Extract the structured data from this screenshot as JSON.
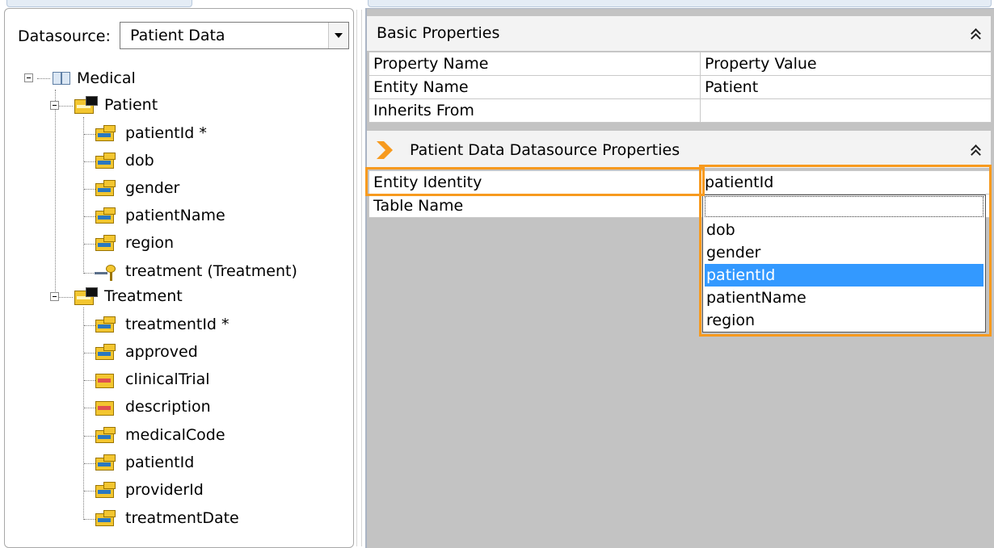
{
  "datasource": {
    "label": "Datasource:",
    "value": "Patient Data"
  },
  "tree": {
    "root": {
      "label": "Medical",
      "icon": "book-icon"
    },
    "patient": {
      "label": "Patient",
      "fields": [
        "patientId *",
        "dob",
        "gender",
        "patientName",
        "region"
      ],
      "relation": "treatment (Treatment)"
    },
    "treatment": {
      "label": "Treatment",
      "fields": [
        "treatmentId *",
        "approved",
        "clinicalTrial",
        "description",
        "medicalCode",
        "patientId",
        "providerId",
        "treatmentDate"
      ]
    }
  },
  "basic_properties": {
    "title": "Basic Properties",
    "col_name": "Property Name",
    "col_value": "Property Value",
    "rows": [
      {
        "name": "Entity Name",
        "value": "Patient"
      },
      {
        "name": "Inherits From",
        "value": ""
      }
    ]
  },
  "datasource_properties": {
    "title": "Patient Data Datasource Properties",
    "rows": [
      {
        "name": "Entity Identity",
        "value": "patientId"
      },
      {
        "name": "Table Name",
        "value": ""
      }
    ]
  },
  "dropdown": {
    "options": [
      "",
      "dob",
      "gender",
      "patientId",
      "patientName",
      "region"
    ],
    "selected": "patientId"
  },
  "colors": {
    "highlight": "#f79a1e",
    "selection": "#3399ff",
    "pane_bg": "#c3c3c3",
    "icon_yellow": "#f3c630"
  }
}
